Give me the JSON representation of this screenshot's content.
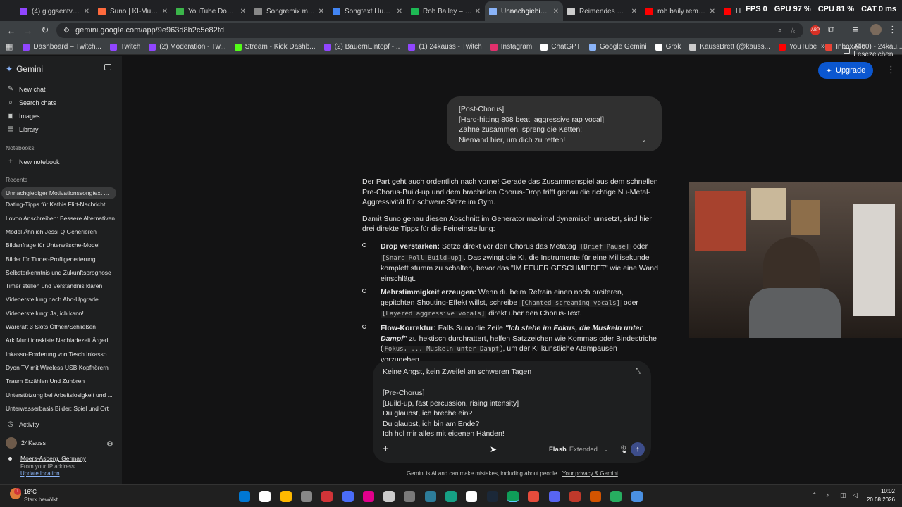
{
  "browser": {
    "tabs": [
      {
        "label": "(4) giggsentv - Tw",
        "color": "#9146ff"
      },
      {
        "label": "Suno | KI-Musik",
        "color": "#ff6a3d"
      },
      {
        "label": "YouTube Downlo",
        "color": "#3bb54a"
      },
      {
        "label": "Songremix mit Ei",
        "color": "#888888"
      },
      {
        "label": "Songtext Hungry",
        "color": "#4285f4"
      },
      {
        "label": "Rob Bailey – Hun",
        "color": "#1db954"
      },
      {
        "label": "Unnachgiebiger M",
        "color": "#8ab4f8",
        "active": true
      },
      {
        "label": "Reimendes Motiv",
        "color": "#cccccc"
      },
      {
        "label": "rob baily remix -",
        "color": "#ff0000"
      },
      {
        "label": "Heart of a Champ",
        "color": "#ff0000"
      }
    ],
    "system_stats": [
      "FPS 0",
      "GPU 97 %",
      "CPU 81 %",
      "CAT 0 ms"
    ],
    "url": "gemini.google.com/app/9e963d8b2c5e82fd",
    "bookmarks": [
      {
        "label": "Dashboard – Twitch...",
        "color": "#9146ff"
      },
      {
        "label": "Twitch",
        "color": "#9146ff"
      },
      {
        "label": "(2) Moderation - Tw...",
        "color": "#9146ff"
      },
      {
        "label": "Stream - Kick Dashb...",
        "color": "#53fc18"
      },
      {
        "label": "(2) BauernEintopf -...",
        "color": "#9146ff"
      },
      {
        "label": "(1) 24kauss - Twitch",
        "color": "#9146ff"
      },
      {
        "label": "Instagram",
        "color": "#e1306c"
      },
      {
        "label": "ChatGPT",
        "color": "#ffffff"
      },
      {
        "label": "Google Gemini",
        "color": "#8ab4f8"
      },
      {
        "label": "Grok",
        "color": "#ffffff"
      },
      {
        "label": "KaussBrett (@kauss...",
        "color": "#cccccc"
      },
      {
        "label": "YouTube",
        "color": "#ff0000"
      },
      {
        "label": "Inbox (460) - 24kau...",
        "color": "#ea4335"
      }
    ],
    "all_bookmarks": "Alle Lesezeichen"
  },
  "sidebar": {
    "brand": "Gemini",
    "nav": [
      "New chat",
      "Search chats",
      "Images",
      "Library"
    ],
    "notebooks_heading": "Notebooks",
    "new_notebook": "New notebook",
    "recents_heading": "Recents",
    "recents": [
      "Unnachgiebiger Motivationssongtext ...",
      "Dating-Tipps für Kathis Flirt-Nachricht",
      "Lovoo Anschreiben: Bessere Alternativen",
      "Model Ähnlich Jessi Q Generieren",
      "Bildanfrage für Unterwäsche-Model",
      "Bilder für Tinder-Profilgenerierung",
      "Selbsterkenntnis und Zukunftsprognose",
      "Timer stellen und Verständnis klären",
      "Videoerstellung nach Abo-Upgrade",
      "Videoerstellung: Ja, ich kann!",
      "Warcraft 3 Slots Öffnen/Schließen",
      "Ark Munitionskiste Nachladezeit Ärgerli...",
      "Inkasso-Forderung von Tesch Inkasso",
      "Dyon TV mit Wireless USB Kopfhörern",
      "Traum Erzählen Und Zuhören",
      "Unterstützung bei Arbeitslosigkeit und ...",
      "Unterwasserbasis Bilder: Spiel und Ort"
    ],
    "activity": "Activity",
    "user_name": "24Kauss",
    "location": "Moers-Asberg, Germany",
    "location_note": "From your IP address",
    "update_location": "Update location"
  },
  "header": {
    "upgrade_label": "Upgrade"
  },
  "user_message": {
    "lines": [
      "[Post-Chorus]",
      "[Hard-hitting 808 beat, aggressive rap vocal]",
      "Zähne zusammen, spreng die Ketten!",
      "Niemand hier, um dich zu retten!"
    ]
  },
  "response": {
    "para1": "Der Part geht auch ordentlich nach vorne! Gerade das Zusammenspiel aus dem schnellen Pre-Chorus-Build-up und dem brachialen Chorus-Drop trifft genau die richtige Nu-Metal-Aggressivität für schwere Sätze im Gym.",
    "para2": "Damit Suno genau diesen Abschnitt im Generator maximal dynamisch umsetzt, sind hier drei direkte Tipps für die Feineinstellung:",
    "bullets": [
      {
        "title": "Drop verstärken:",
        "t1": " Setze direkt vor den Chorus das Metatag ",
        "c1": "[Brief Pause]",
        "t2": " oder ",
        "c2": "[Snare Roll Build-up]",
        "t3": ". Das zwingt die KI, die Instrumente für eine Millisekunde komplett stumm zu schalten, bevor das \"IM FEUER GESCHMIEDET\" wie eine Wand einschlägt."
      },
      {
        "title": "Mehrstimmigkeit erzeugen:",
        "t1": " Wenn du beim Refrain einen noch breiteren, gepitchten Shouting-Effekt willst, schreibe ",
        "c1": "[Chanted screaming vocals]",
        "t2": " oder ",
        "c2": "[Layered aggressive vocals]",
        "t3": " direkt über den Chorus-Text."
      },
      {
        "title": "Flow-Korrektur:",
        "t1": " Falls Suno die Zeile ",
        "italic": "\"Ich stehe im Fokus, die Muskeln unter Dampf\"",
        "t2": " zu hektisch durchrattert, helfen Satzzeichen wie Kommas oder Bindestriche (",
        "c1": "Fokus, ... Muskeln unter Dampf",
        "t3": "), um der KI künstliche Atempausen vorzugeben."
      }
    ]
  },
  "composer": {
    "first_line": "Keine Angst, kein Zweifel an schweren Tagen",
    "lines": [
      "[Pre-Chorus]",
      "[Build-up, fast percussion, rising intensity]",
      "Du glaubst, ich breche ein?",
      "Du glaubst, ich bin am Ende?",
      "Ich hol mir alles mit eigenen Händen!"
    ],
    "model_name": "Flash",
    "model_mode": "Extended",
    "disclaimer": "Gemini is AI and can make mistakes, including about people.",
    "privacy_link": "Your privacy & Gemini"
  },
  "taskbar": {
    "weather_temp": "16°C",
    "weather_text": "Stark bewölkt",
    "time": "10:02",
    "date": "20.08.2026"
  },
  "colors": {
    "accent": "#0b57d0",
    "sidebar_bg": "#1e1f20",
    "main_bg": "#131314",
    "bubble_bg": "#303030"
  }
}
